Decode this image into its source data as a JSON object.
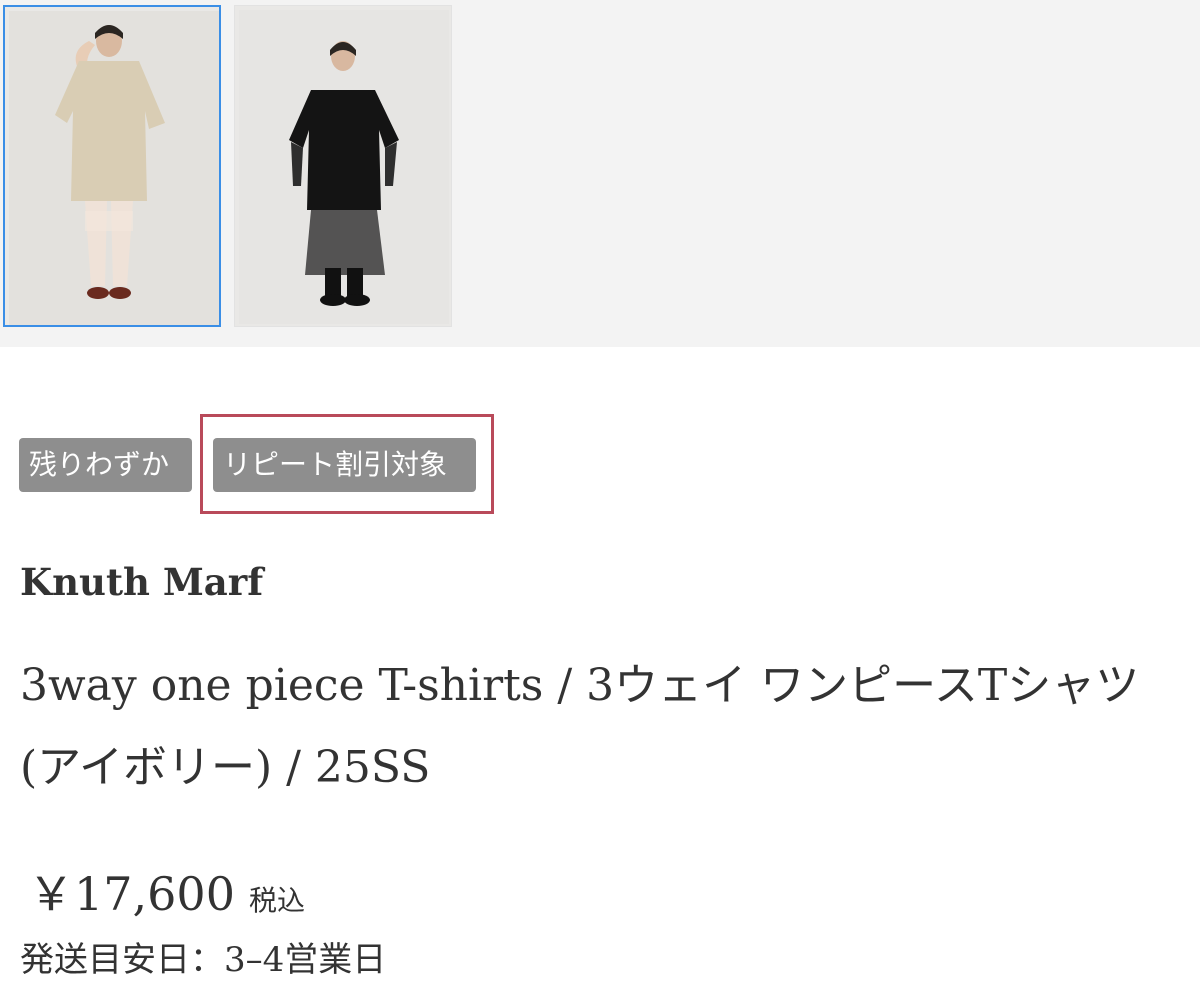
{
  "gallery": {
    "thumbnails": [
      {
        "alt": "model wearing ivory T-shirt dress with lace leggings",
        "selected": true
      },
      {
        "alt": "model wearing black T-shirt with lace skirt",
        "selected": false
      }
    ],
    "selected_border_color": "#3a8ee6"
  },
  "badges": [
    {
      "label": "残りわずか"
    },
    {
      "label": "リピート割引対象"
    }
  ],
  "badge_color": "#8e8e8e",
  "highlight_color": "#b94a5a",
  "product": {
    "brand": "Knuth Marf",
    "title": "3way one piece T-shirts / 3ウェイ ワンピースTシャツ(アイボリー) / 25SS",
    "price": "￥17,600",
    "tax_label": "税込",
    "shipping": "発送目安日：3–4営業日"
  }
}
